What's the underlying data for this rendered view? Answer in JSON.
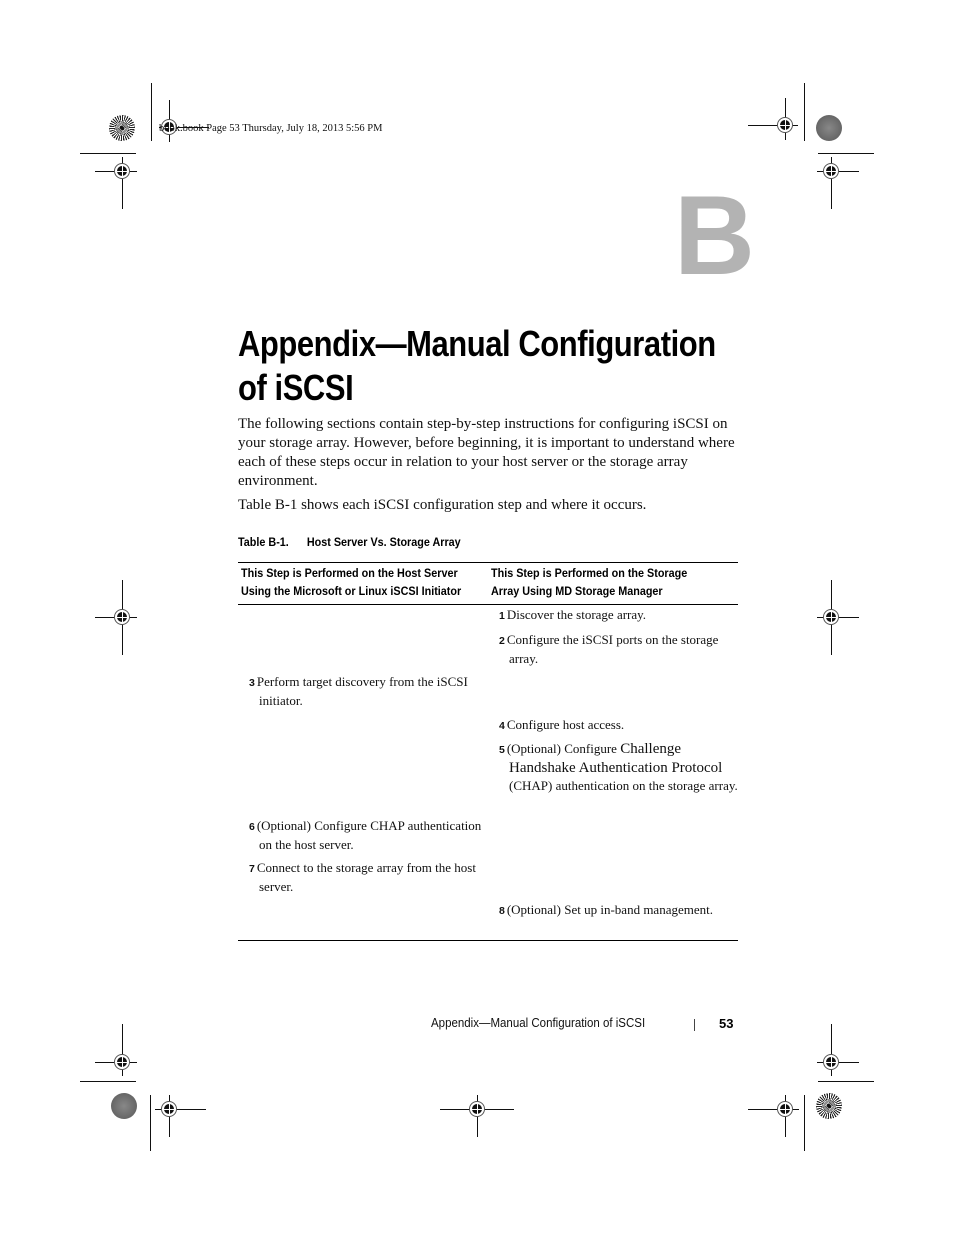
{
  "slug": "book.book  Page 53  Thursday, July 18, 2013  5:56 PM",
  "chapter_letter": "B",
  "title_line1": "Appendix—Manual Configuration",
  "title_line2": "of iSCSI",
  "paragraphs": [
    "The following sections contain step-by-step instructions for configuring iSCSI on your storage array. However, before beginning, it is important to understand where each of these steps occur in relation to your host server or the storage array environment.",
    "Table B-1 shows each iSCSI configuration step and where it occurs."
  ],
  "table": {
    "caption_label": "Table B-1.",
    "caption_title": "Host Server Vs. Storage Array",
    "headers": {
      "host_line1": "This Step is Performed on the Host Server",
      "host_line2": "Using the Microsoft or Linux iSCSI Initiator",
      "storage_line1": "This Step is Performed on the Storage",
      "storage_line2": "Array Using MD Storage Manager"
    },
    "steps": [
      {
        "num": "1",
        "column": "storage",
        "text": "Discover the storage array."
      },
      {
        "num": "2",
        "column": "storage",
        "text": "Configure the iSCSI ports on the storage array."
      },
      {
        "num": "3",
        "column": "host",
        "text": "Perform target discovery from the iSCSI initiator."
      },
      {
        "num": "4",
        "column": "storage",
        "text": "Configure host access."
      },
      {
        "num": "5",
        "column": "storage",
        "text_a": "(Optional) Configure ",
        "text_b": "Challenge Handshake Authentication Protocol",
        "text_c": " (CHAP) authentication on the storage array."
      },
      {
        "num": "6",
        "column": "host",
        "text": "(Optional) Configure CHAP authentication on the host server."
      },
      {
        "num": "7",
        "column": "host",
        "text": "Connect to the storage array from the host server."
      },
      {
        "num": "8",
        "column": "storage",
        "text": "(Optional) Set up in-band management."
      }
    ]
  },
  "footer": {
    "running_title": "Appendix—Manual Configuration of iSCSI",
    "page_number": "53"
  }
}
